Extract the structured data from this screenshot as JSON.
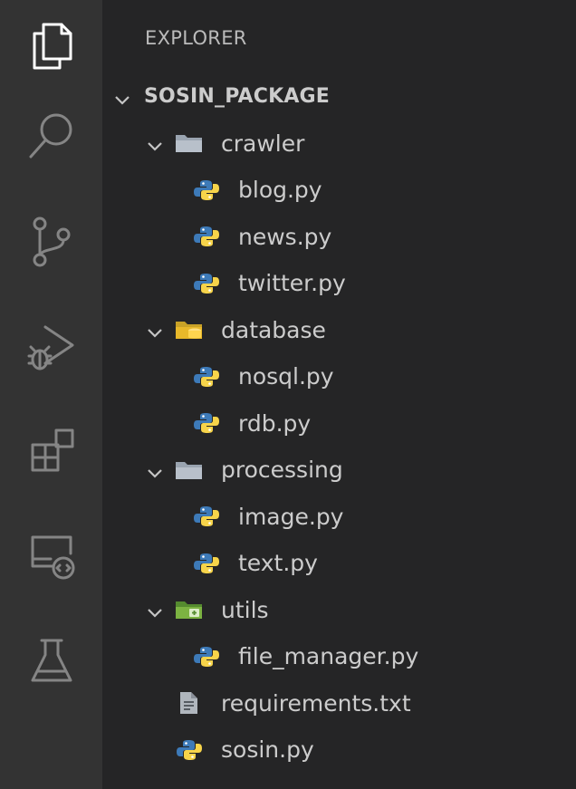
{
  "explorer": {
    "title": "EXPLORER",
    "root": "SOSIN_PACKAGE"
  },
  "activity_bar": [
    {
      "name": "explorer-icon",
      "active": true
    },
    {
      "name": "search-icon",
      "active": false
    },
    {
      "name": "source-control-icon",
      "active": false
    },
    {
      "name": "run-debug-icon",
      "active": false
    },
    {
      "name": "extensions-icon",
      "active": false
    },
    {
      "name": "remote-explorer-icon",
      "active": false
    },
    {
      "name": "testing-icon",
      "active": false
    }
  ],
  "tree": [
    {
      "label": "crawler",
      "kind": "folder",
      "level": 1,
      "icon": "folder-icon"
    },
    {
      "label": "blog.py",
      "kind": "file",
      "level": 2,
      "icon": "python-icon"
    },
    {
      "label": "news.py",
      "kind": "file",
      "level": 2,
      "icon": "python-icon"
    },
    {
      "label": "twitter.py",
      "kind": "file",
      "level": 2,
      "icon": "python-icon"
    },
    {
      "label": "database",
      "kind": "folder",
      "level": 1,
      "icon": "database-folder-icon"
    },
    {
      "label": "nosql.py",
      "kind": "file",
      "level": 2,
      "icon": "python-icon"
    },
    {
      "label": "rdb.py",
      "kind": "file",
      "level": 2,
      "icon": "python-icon"
    },
    {
      "label": "processing",
      "kind": "folder",
      "level": 1,
      "icon": "folder-icon"
    },
    {
      "label": "image.py",
      "kind": "file",
      "level": 2,
      "icon": "python-icon"
    },
    {
      "label": "text.py",
      "kind": "file",
      "level": 2,
      "icon": "python-icon"
    },
    {
      "label": "utils",
      "kind": "folder",
      "level": 1,
      "icon": "utils-folder-icon"
    },
    {
      "label": "file_manager.py",
      "kind": "file",
      "level": 2,
      "icon": "python-icon"
    },
    {
      "label": "requirements.txt",
      "kind": "file",
      "level": 1,
      "icon": "text-file-icon"
    },
    {
      "label": "sosin.py",
      "kind": "file",
      "level": 1,
      "icon": "python-icon"
    }
  ],
  "colors": {
    "activity_bg": "#333333",
    "sidebar_bg": "#252526",
    "text": "#cccccc",
    "python_blue": "#3d7ab8",
    "python_yellow": "#f7d44a",
    "folder_grey": "#9aa4b0",
    "database_yellow": "#e8b82a",
    "utils_green": "#7cb342"
  }
}
